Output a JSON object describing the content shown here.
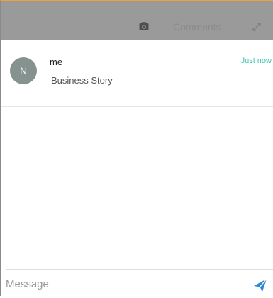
{
  "header": {
    "title": "Comments",
    "camera_icon": "camera-icon",
    "expand_icon": "expand-icon"
  },
  "messages": [
    {
      "avatar_initial": "N",
      "author": "me",
      "text": "Business Story",
      "time": "Just now"
    }
  ],
  "composer": {
    "placeholder": "Message",
    "value": "",
    "send_icon": "send-icon"
  },
  "colors": {
    "header_bg": "#9a9a9a",
    "accent_border": "#f0a03c",
    "time_text": "#3cc3b0",
    "send_icon": "#2f87d6",
    "avatar_bg": "#86928f"
  }
}
